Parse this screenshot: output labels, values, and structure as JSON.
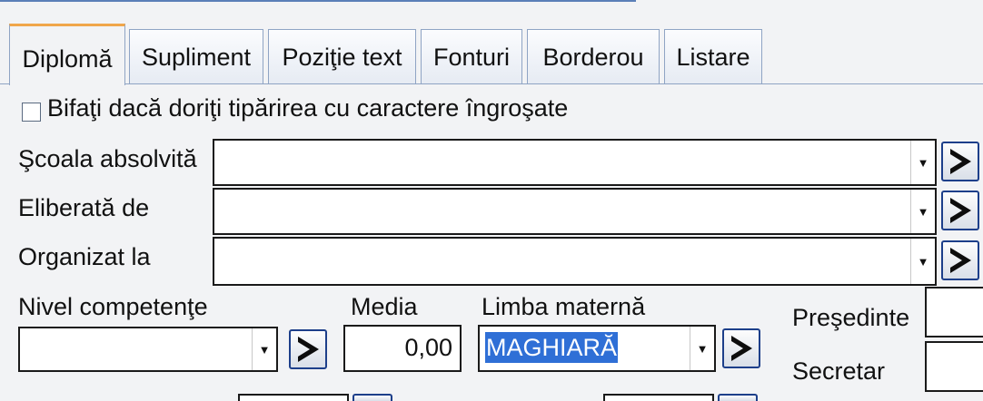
{
  "tabs": [
    {
      "label": "Diplomă"
    },
    {
      "label": "Supliment"
    },
    {
      "label": "Poziţie text"
    },
    {
      "label": "Fonturi"
    },
    {
      "label": "Borderou"
    },
    {
      "label": "Listare"
    }
  ],
  "bold_checkbox": {
    "label": "Bifaţi dacă doriţi tipărirea cu caractere îngroşate",
    "checked": false
  },
  "fields": {
    "scoala": {
      "label": "Şcoala absolvită",
      "value": ""
    },
    "eliberata": {
      "label": "Eliberată de",
      "value": ""
    },
    "organizat": {
      "label": "Organizat la",
      "value": ""
    },
    "nivel": {
      "label": "Nivel competenţe",
      "value": ""
    },
    "media": {
      "label": "Media",
      "value": "0,00"
    },
    "limba": {
      "label": "Limba maternă",
      "value": "MAGHIARĂ"
    },
    "presedinte": {
      "label": "Preşedinte",
      "value": ""
    },
    "secretar": {
      "label": "Secretar",
      "value": ""
    }
  },
  "icons": {
    "dropdown": "dropdown-arrow-icon",
    "go": "chevron-right-icon"
  },
  "colors": {
    "active_tab_accent": "#f0a64a",
    "selection": "#2f6fd6",
    "button_border": "#1d3f8a"
  }
}
